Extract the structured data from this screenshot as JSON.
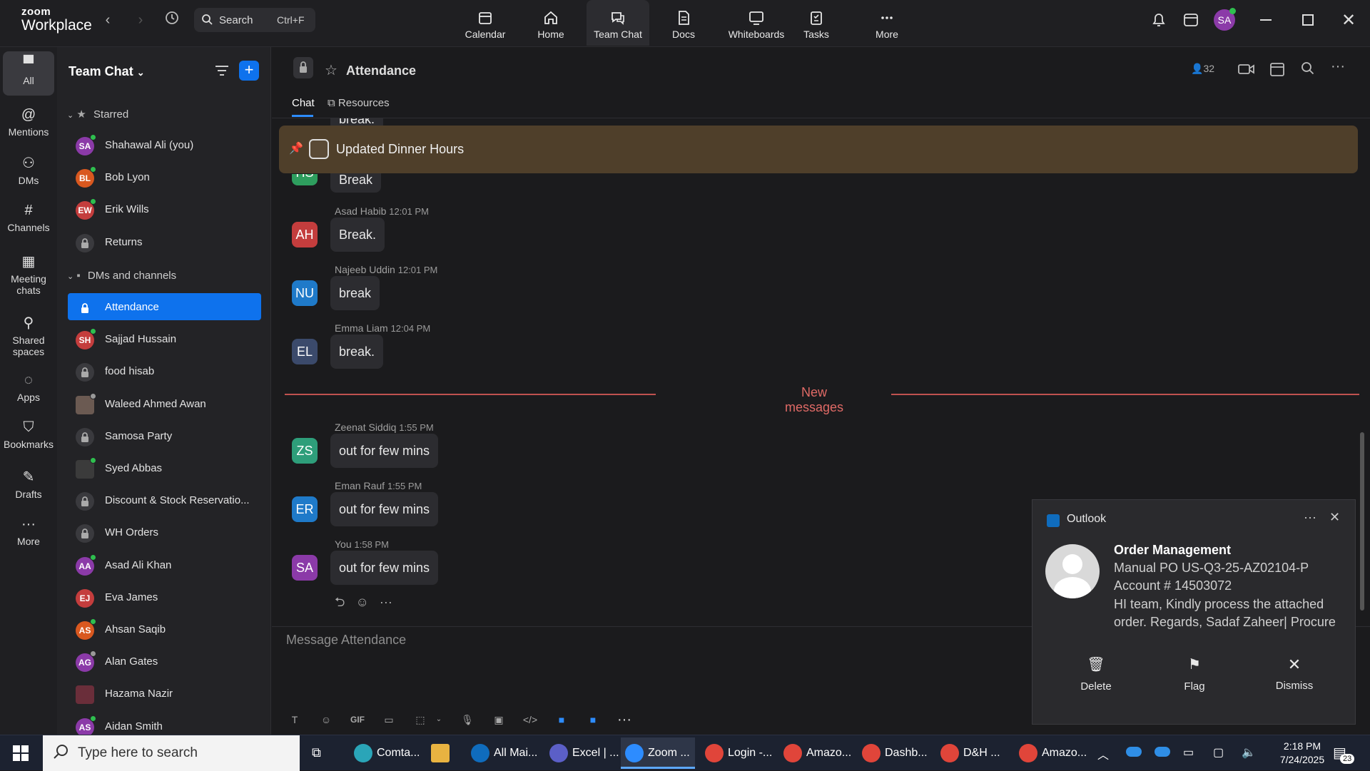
{
  "app": {
    "logo_line1": "zoom",
    "logo_line2": "Workplace"
  },
  "search": {
    "label": "Search",
    "shortcut": "Ctrl+F"
  },
  "topnav": [
    {
      "label": "Calendar",
      "icon": "calendar-icon"
    },
    {
      "label": "Home",
      "icon": "home-icon"
    },
    {
      "label": "Team Chat",
      "icon": "chat-icon",
      "active": true
    },
    {
      "label": "Docs",
      "icon": "docs-icon"
    },
    {
      "label": "Whiteboards",
      "icon": "whiteboard-icon"
    },
    {
      "label": "Tasks",
      "icon": "tasks-icon"
    },
    {
      "label": "More",
      "icon": "more-icon"
    }
  ],
  "user": {
    "initials": "SA",
    "color": "#8b3aa8"
  },
  "rail": [
    {
      "label": "All",
      "active": true
    },
    {
      "label": "Mentions"
    },
    {
      "label": "DMs"
    },
    {
      "label": "Channels"
    },
    {
      "label": "Meeting chats"
    },
    {
      "label": "Shared spaces"
    },
    {
      "label": "Apps"
    },
    {
      "label": "Bookmarks"
    },
    {
      "label": "Drafts"
    },
    {
      "label": "More"
    }
  ],
  "sidebar": {
    "title": "Team Chat",
    "starred_label": "Starred",
    "starred": [
      {
        "name": "Shahawal Ali (you)",
        "initials": "SA",
        "color": "#8b3aa8",
        "status": "online"
      },
      {
        "name": "Bob Lyon",
        "initials": "BL",
        "color": "#d9581f",
        "status": "online"
      },
      {
        "name": "Erik Wills",
        "initials": "EW",
        "color": "#c43d3d",
        "status": "online"
      },
      {
        "name": "Returns",
        "type": "channel"
      }
    ],
    "dms_label": "DMs and channels",
    "dms": [
      {
        "name": "Attendance",
        "type": "channel",
        "selected": true
      },
      {
        "name": "Sajjad Hussain",
        "initials": "SH",
        "color": "#c43d3d",
        "status": "online"
      },
      {
        "name": "food hisab",
        "type": "channel"
      },
      {
        "name": "Waleed Ahmed Awan",
        "initials": "",
        "color": "#6b5a52",
        "status": "offline"
      },
      {
        "name": "Samosa Party",
        "type": "channel"
      },
      {
        "name": "Syed Abbas",
        "initials": "",
        "color": "#3b3b3b",
        "status": "online"
      },
      {
        "name": "Discount & Stock Reservatio...",
        "type": "channel"
      },
      {
        "name": "WH Orders",
        "type": "channel"
      },
      {
        "name": "Asad Ali Khan",
        "initials": "AA",
        "color": "#8b3aa8",
        "status": "online"
      },
      {
        "name": "Eva James",
        "initials": "EJ",
        "color": "#c43d3d",
        "status": "none"
      },
      {
        "name": "Ahsan Saqib",
        "initials": "AS",
        "color": "#d9581f",
        "status": "online"
      },
      {
        "name": "Alan Gates",
        "initials": "AG",
        "color": "#8b3aa8",
        "status": "offline"
      },
      {
        "name": "Hazama Nazir",
        "initials": "",
        "color": "#6a2e3a",
        "status": "none"
      },
      {
        "name": "Aidan Smith",
        "initials": "AS",
        "color": "#8b3aa8",
        "status": "online"
      }
    ]
  },
  "channel": {
    "title": "Attendance",
    "member_count": "32",
    "tabs": [
      "Chat",
      "Resources"
    ],
    "pinned": "Updated Dinner Hours",
    "top_clipped": [
      {
        "initials": "HS",
        "color": "#2e9e5e",
        "text": "Break"
      }
    ],
    "messages": [
      {
        "sender": "Asad Habib",
        "time": "12:01 PM",
        "initials": "AH",
        "color": "#c43d3d",
        "text": "Break."
      },
      {
        "sender": "Najeeb Uddin",
        "time": "12:01 PM",
        "initials": "NU",
        "color": "#1f7ac9",
        "text": "break"
      },
      {
        "sender": "Emma Liam",
        "time": "12:04 PM",
        "initials": "EL",
        "color": "#3b4a6b",
        "text": "break."
      }
    ],
    "new_messages_label": "New messages",
    "new_messages": [
      {
        "sender": "Zeenat Siddiq",
        "time": "1:55 PM",
        "initials": "ZS",
        "color": "#2e9e7a",
        "text": "out for few mins"
      },
      {
        "sender": "Eman Rauf",
        "time": "1:55 PM",
        "initials": "ER",
        "color": "#1f7ac9",
        "text": "out for few mins"
      },
      {
        "sender": "You",
        "time": "1:58 PM",
        "initials": "SA",
        "color": "#8b3aa8",
        "text": "out for few mins"
      }
    ],
    "composer_placeholder": "Message Attendance",
    "clipped_top_text": "break."
  },
  "toast": {
    "app": "Outlook",
    "title": "Order Management",
    "line1": "Manual PO   US-Q3-25-AZ02104-P",
    "line2": "Account # 14503072",
    "line3": "HI team,  Kindly  process the attached",
    "line4": "order.  Regards,  Sadaf Zaheer| Procure",
    "actions": [
      "Delete",
      "Flag",
      "Dismiss"
    ]
  },
  "taskbar": {
    "search_placeholder": "Type here to search",
    "apps": [
      {
        "label": "Comta...",
        "color": "#2aa5b8"
      },
      {
        "label": "",
        "color": "#e8b341"
      },
      {
        "label": "All Mai...",
        "color": "#0f6cbd"
      },
      {
        "label": "Excel | ...",
        "color": "#5b5fc7"
      },
      {
        "label": "Zoom ...",
        "color": "#2d8cff",
        "active": true
      },
      {
        "label": "Login -...",
        "color": "#e0453a"
      },
      {
        "label": "Amazo...",
        "color": "#e0453a"
      },
      {
        "label": "Dashb...",
        "color": "#e0453a"
      },
      {
        "label": "D&H ...",
        "color": "#e0453a"
      },
      {
        "label": "Amazo...",
        "color": "#e0453a"
      }
    ],
    "time": "2:18 PM",
    "date": "7/24/2025",
    "notif_count": "23"
  }
}
